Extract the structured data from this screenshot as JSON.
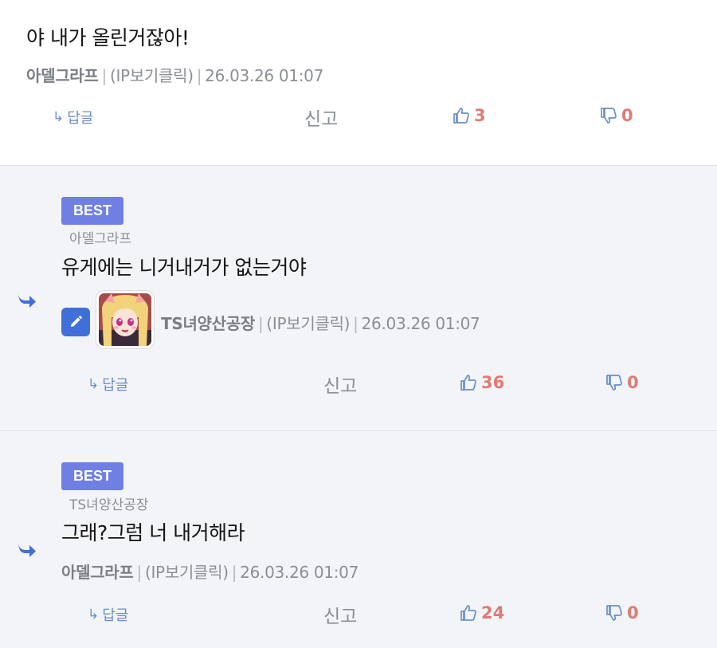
{
  "comments": [
    {
      "content": "야 내가 올린거잖아!",
      "author": "아델그라프",
      "ip": "(IP보기클릭)",
      "date": "26.03.26 01:07",
      "actions": {
        "reply": "답글",
        "report": "신고",
        "likes": "3",
        "dislikes": "0"
      }
    },
    {
      "badge": "BEST",
      "reply_to": "아델그라프",
      "content": "유게에는 니거내거가 없는거야",
      "author": "TS녀양산공장",
      "ip": "(IP보기클릭)",
      "date": "26.03.26 01:07",
      "actions": {
        "reply": "답글",
        "report": "신고",
        "likes": "36",
        "dislikes": "0"
      }
    },
    {
      "badge": "BEST",
      "reply_to": "TS녀양산공장",
      "content": "그래?그럼 너 내거해라",
      "author": "아델그라프",
      "ip": "(IP보기클릭)",
      "date": "26.03.26 01:07",
      "actions": {
        "reply": "답글",
        "report": "신고",
        "likes": "24",
        "dislikes": "0"
      }
    }
  ],
  "colors": {
    "accent_blue": "#3f6fd8",
    "best_badge": "#6f7fe3",
    "count_red": "#e07a74",
    "meta_gray": "#8a8f97",
    "reply_bg": "#f2f4f7"
  },
  "icons": {
    "reply_arrow": "reply-arrow-icon",
    "thumbs_up": "thumbs-up-icon",
    "thumbs_down": "thumbs-down-icon",
    "reply_indicator": "reply-indicator-icon",
    "edit": "pencil-icon"
  }
}
